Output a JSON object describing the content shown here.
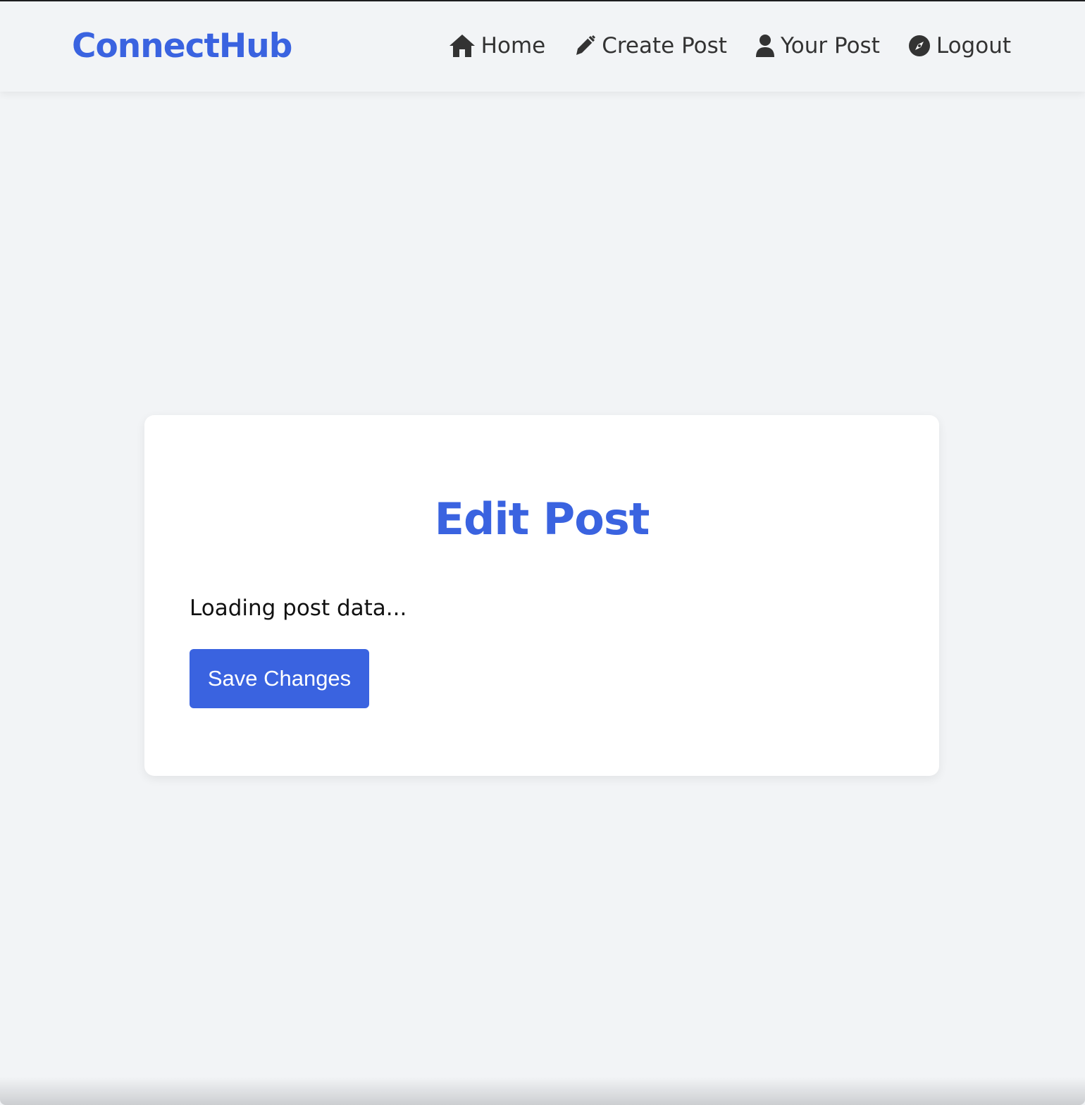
{
  "header": {
    "brand": "ConnectHub",
    "nav": [
      {
        "label": "Home",
        "icon": "home-icon"
      },
      {
        "label": "Create Post",
        "icon": "pen-icon"
      },
      {
        "label": "Your Post",
        "icon": "user-icon"
      },
      {
        "label": "Logout",
        "icon": "compass-icon"
      }
    ]
  },
  "card": {
    "title": "Edit Post",
    "status": "Loading post data...",
    "save_label": "Save Changes"
  },
  "colors": {
    "accent": "#3a63e0",
    "background": "#f2f4f6",
    "card": "#ffffff",
    "nav_text": "#333333"
  }
}
